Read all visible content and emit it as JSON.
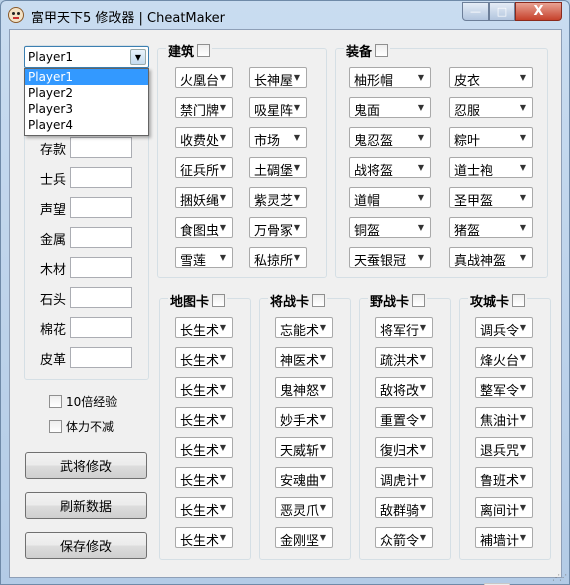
{
  "window": {
    "title": "富甲天下5 修改器 | CheatMaker",
    "min_glyph": "—",
    "max_glyph": "□",
    "close_glyph": "X",
    "icon": "cartoon-face-icon"
  },
  "player": {
    "selected": "Player1",
    "options": [
      "Player1",
      "Player2",
      "Player3",
      "Player4"
    ]
  },
  "fields": [
    {
      "label": "存款",
      "value": ""
    },
    {
      "label": "士兵",
      "value": ""
    },
    {
      "label": "声望",
      "value": ""
    },
    {
      "label": "金属",
      "value": ""
    },
    {
      "label": "木材",
      "value": ""
    },
    {
      "label": "石头",
      "value": ""
    },
    {
      "label": "棉花",
      "value": ""
    },
    {
      "label": "皮革",
      "value": ""
    }
  ],
  "checks": {
    "exp10": "10倍经验",
    "no_stamina": "体力不减"
  },
  "buttons": {
    "general": "武将修改",
    "refresh": "刷新数据",
    "save": "保存修改"
  },
  "groups": {
    "building": {
      "title": "建筑",
      "items": [
        "火凰台",
        "长神屋",
        "禁门牌",
        "吸星阵",
        "收费处",
        "市场",
        "征兵所",
        "土碉堡",
        "捆妖绳",
        "紫灵芝",
        "食图虫",
        "万骨冢",
        "雪莲",
        "私掠所"
      ]
    },
    "equipment": {
      "title": "装备",
      "items": [
        "柚形帽",
        "皮衣",
        "鬼面",
        "忍服",
        "鬼忍盔",
        "粽叶",
        "战将盔",
        "道士袍",
        "道帽",
        "圣甲盔",
        "铜盔",
        "猪盔",
        "天蚕银冠",
        "真战神盔"
      ]
    },
    "map_cards": {
      "title": "地图卡",
      "items": [
        "长生术",
        "长生术",
        "长生术",
        "长生术",
        "长生术",
        "长生术",
        "长生术",
        "长生术"
      ]
    },
    "general_cards": {
      "title": "将战卡",
      "items": [
        "忘能术",
        "神医术",
        "鬼神怒",
        "妙手术",
        "天威斩",
        "安魂曲",
        "恶灵爪",
        "金刚坚"
      ]
    },
    "field_cards": {
      "title": "野战卡",
      "items": [
        "将军行",
        "疏洪术",
        "敌将改",
        "重置令",
        "復归术",
        "调虎计",
        "敌群骑",
        "众箭令"
      ]
    },
    "siege_cards": {
      "title": "攻城卡",
      "items": [
        "调兵令",
        "烽火台",
        "整军令",
        "焦油计",
        "退兵咒",
        "鲁班术",
        "离间计",
        "補墙计"
      ]
    }
  }
}
